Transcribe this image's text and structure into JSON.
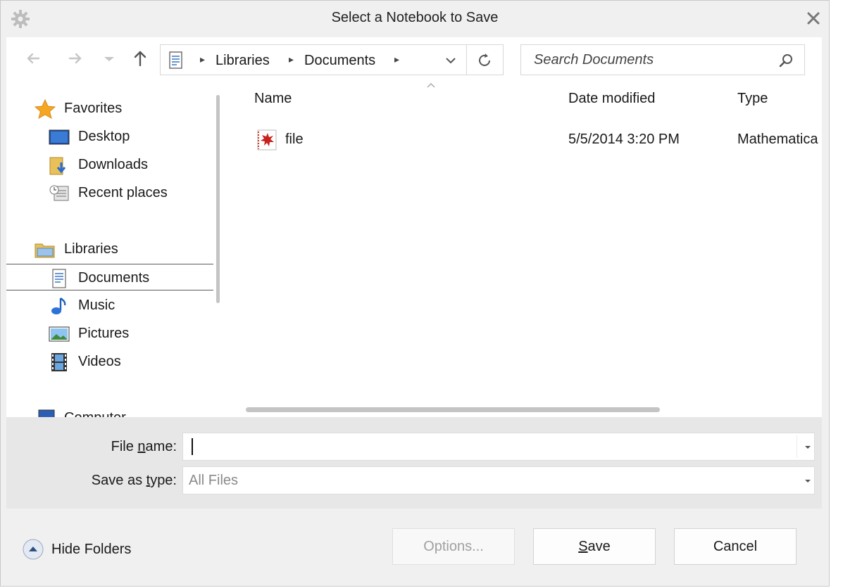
{
  "window": {
    "title": "Select a Notebook to Save"
  },
  "nav": {
    "breadcrumb": [
      "Libraries",
      "Documents"
    ],
    "search_placeholder": "Search Documents"
  },
  "sidebar": {
    "favorites": {
      "label": "Favorites",
      "icon": "star-icon"
    },
    "favorite_items": [
      {
        "label": "Desktop",
        "icon": "desktop-icon"
      },
      {
        "label": "Downloads",
        "icon": "downloads-folder-icon"
      },
      {
        "label": "Recent places",
        "icon": "recent-places-icon"
      }
    ],
    "libraries": {
      "label": "Libraries",
      "icon": "libraries-folder-icon"
    },
    "library_items": [
      {
        "label": "Documents",
        "icon": "documents-icon",
        "selected": true
      },
      {
        "label": "Music",
        "icon": "music-note-icon"
      },
      {
        "label": "Pictures",
        "icon": "pictures-icon"
      },
      {
        "label": "Videos",
        "icon": "videos-icon"
      }
    ],
    "computer": {
      "label": "Computer",
      "icon": "computer-icon"
    }
  },
  "files": {
    "columns": [
      "Name",
      "Date modified",
      "Type"
    ],
    "rows": [
      {
        "name": "file",
        "date_modified": "5/5/2014 3:20 PM",
        "type": "Mathematica",
        "icon": "mathematica-notebook-icon"
      }
    ]
  },
  "form": {
    "file_name_label_pre": "File ",
    "file_name_label_u": "n",
    "file_name_label_post": "ame:",
    "file_name_value": "",
    "save_type_label_pre": "Save as ",
    "save_type_label_u": "t",
    "save_type_label_post": "ype:",
    "save_type_value": "All Files"
  },
  "buttons": {
    "hide_folders": "Hide Folders",
    "options": "Options...",
    "save_u": "S",
    "save_rest": "ave",
    "cancel": "Cancel"
  },
  "colors": {
    "accent_star": "#f5a623",
    "selected_border": "#5a5a5a",
    "form_bg": "#e7e7e7",
    "window_bg": "#f0f0f0"
  }
}
